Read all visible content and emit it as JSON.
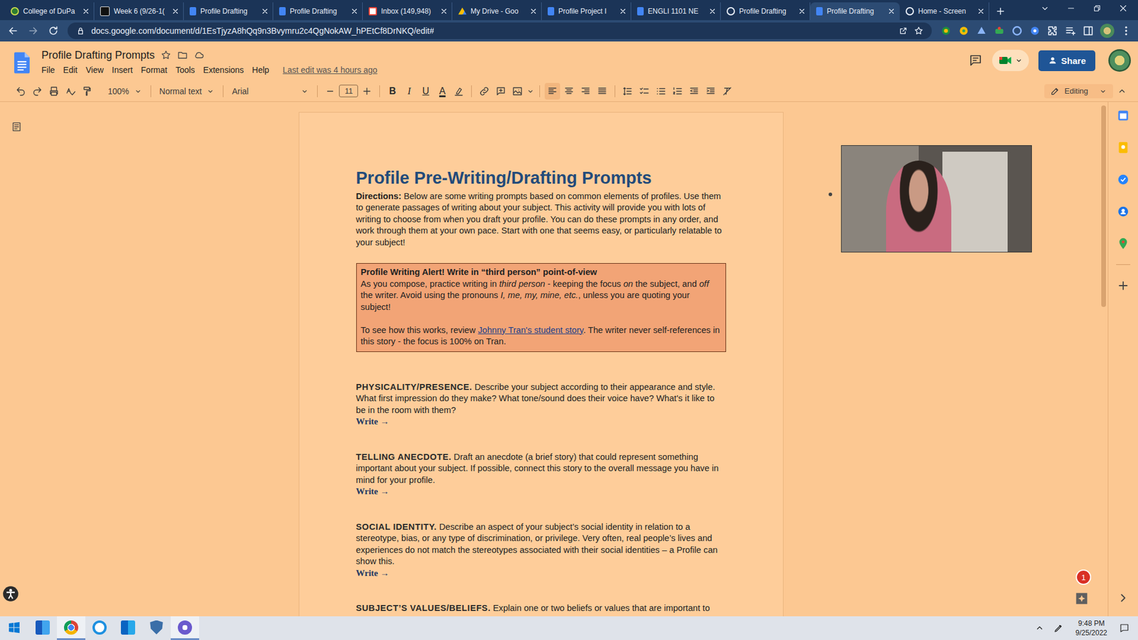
{
  "browser": {
    "tabs": [
      {
        "label": "College of DuPa",
        "kind": "college",
        "selected": false
      },
      {
        "label": "Week 6 (9/26-1(",
        "kind": "course",
        "selected": false
      },
      {
        "label": "Profile Drafting",
        "kind": "docs",
        "selected": false
      },
      {
        "label": "Profile Drafting",
        "kind": "docs",
        "selected": false
      },
      {
        "label": "Inbox (149,948)",
        "kind": "mail",
        "selected": false
      },
      {
        "label": "My Drive - Goo",
        "kind": "drive",
        "selected": false
      },
      {
        "label": "Profile Project I",
        "kind": "docs",
        "selected": false
      },
      {
        "label": "ENGLI 1101 NE",
        "kind": "docs",
        "selected": false
      },
      {
        "label": "Profile Drafting",
        "kind": "screen",
        "selected": false
      },
      {
        "label": "Profile Drafting",
        "kind": "docs",
        "selected": true
      },
      {
        "label": "Home - Screen",
        "kind": "screen",
        "selected": false
      }
    ],
    "url": "docs.google.com/document/d/1EsTjyzA8hQq9n3Bvymru2c4QgNokAW_hPEtCf8DrNKQ/edit#"
  },
  "docs": {
    "title": "Profile Drafting Prompts",
    "menus": [
      "File",
      "Edit",
      "View",
      "Insert",
      "Format",
      "Tools",
      "Extensions",
      "Help"
    ],
    "last_edit": "Last edit was 4 hours ago",
    "share": "Share",
    "mode": "Editing",
    "notification_badge": "1"
  },
  "toolbar": {
    "zoom": "100%",
    "style": "Normal text",
    "font": "Arial",
    "size": "11",
    "bold": "B",
    "italic": "I",
    "underline": "U",
    "text_color": "A",
    "alignment": [
      {
        "name": "left",
        "selected": true
      },
      {
        "name": "center",
        "selected": false
      },
      {
        "name": "right",
        "selected": false
      },
      {
        "name": "justify",
        "selected": false
      }
    ]
  },
  "document": {
    "heading": "Profile Pre-Writing/Drafting Prompts",
    "directions": {
      "label": "Directions:",
      "text": " Below are some writing prompts based on common elements of profiles. Use them to generate passages of writing about your subject. This activity will provide you with lots of writing to choose from when you draft your profile. You can do these prompts in any order, and work through them at your own pace. Start with one that seems easy, or particularly relatable to your subject!"
    },
    "alert": {
      "title": "Profile Writing Alert! Write in “third person” point-of-view",
      "body": [
        {
          "text": "As you compose, practice writing in ",
          "style": "normal"
        },
        {
          "text": "third person",
          "style": "italic"
        },
        {
          "text": " - keeping the focus ",
          "style": "normal"
        },
        {
          "text": "on",
          "style": "italic"
        },
        {
          "text": " the subject, and ",
          "style": "normal"
        },
        {
          "text": "off",
          "style": "italic"
        },
        {
          "text": " the writer. Avoid using the pronouns ",
          "style": "normal"
        },
        {
          "text": "I, me, my, mine, etc.",
          "style": "italic"
        },
        {
          "text": ", unless you are quoting your subject!",
          "style": "normal"
        }
      ],
      "review": [
        {
          "text": "To see how this works, review ",
          "style": "normal"
        },
        {
          "text": "Johnny Tran's student story",
          "style": "link"
        },
        {
          "text": ". The writer never self-references in this story - the focus is 100% on Tran.",
          "style": "normal"
        }
      ]
    },
    "prompts": [
      {
        "heading": "PHYSICALITY/PRESENCE.",
        "text": " Describe your subject according to their appearance and style. What first impression do they make? What tone/sound does their voice have? What's it like to be in the room with them?",
        "action": "Write →"
      },
      {
        "heading": "TELLING ANECDOTE.",
        "text": " Draft an anecdote (a brief story) that could represent something important about your subject. If possible, connect this story to the overall message you have in mind for your profile.",
        "action": "Write →"
      },
      {
        "heading": "SOCIAL IDENTITY.",
        "text": " Describe an aspect of your subject’s social identity in relation to a stereotype, bias, or any type of discrimination, or privilege. Very often, real people’s lives and experiences do not match the stereotypes associated with their social identities – a Profile can show this.",
        "action": "Write →"
      },
      {
        "heading": "SUBJECT’S VALUES/BELIEFS.",
        "text": " Explain one or two beliefs or values that are important to",
        "action": ""
      }
    ]
  },
  "taskbar": {
    "apps": [
      {
        "kind": "word",
        "selected": false
      },
      {
        "kind": "chrome",
        "selected": true
      },
      {
        "kind": "ie",
        "selected": false
      },
      {
        "kind": "outlook",
        "selected": false
      },
      {
        "kind": "defender",
        "selected": false
      },
      {
        "kind": "screencast",
        "selected": true
      }
    ],
    "time": "9:48 PM",
    "date": "9/25/2022"
  }
}
